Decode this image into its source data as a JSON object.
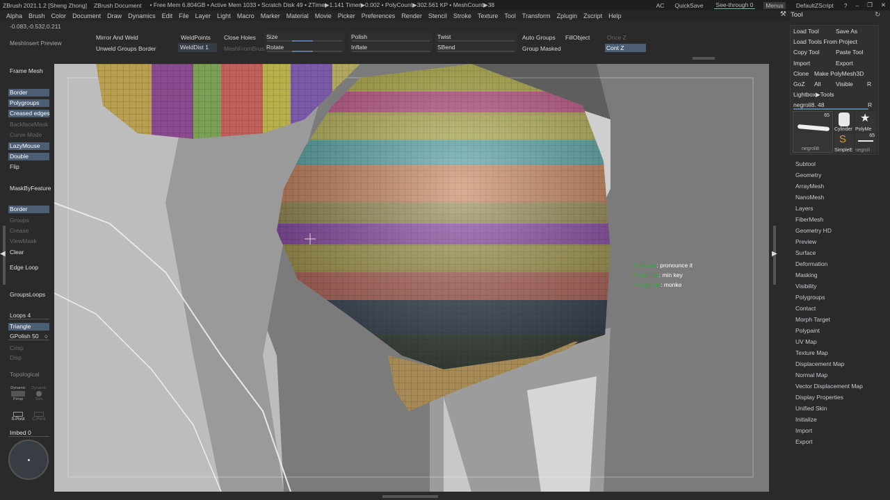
{
  "titlebar": {
    "app": "ZBrush 2021.1.2 [Sheng Zhong]",
    "document": "ZBrush Document",
    "stats": "• Free Mem 6.804GB • Active Mem 1033 • Scratch Disk 49 • ZTime▶1.141 Timer▶0.002 • PolyCount▶302.561 KP • MeshCount▶38",
    "ac": "AC",
    "quicksave": "QuickSave",
    "seethrough": "See-through  0",
    "menus": "Menus",
    "script": "DefaultZScript"
  },
  "menubar": [
    "Alpha",
    "Brush",
    "Color",
    "Document",
    "Draw",
    "Dynamics",
    "Edit",
    "File",
    "Layer",
    "Light",
    "Macro",
    "Marker",
    "Material",
    "Movie",
    "Picker",
    "Preferences",
    "Render",
    "Stencil",
    "Stroke",
    "Texture",
    "Tool",
    "Transform",
    "Zplugin",
    "Zscript",
    "Help"
  ],
  "coords": "-0.083,-0.532,0.211",
  "meshinsert": "MeshInsert Preview",
  "top": {
    "mirror_weld": "Mirror And Weld",
    "unweld_groups": "Unweld Groups Border",
    "weldpoints": "WeldPoints",
    "welddist": "WeldDist 1",
    "close_holes": "Close Holes",
    "meshfrombrush": "MeshFromBrus",
    "size": "Size",
    "rotate": "Rotate",
    "polish": "Polish",
    "inflate": "Inflate",
    "twist": "Twist",
    "sbend": "SBend",
    "auto_groups": "Auto Groups",
    "group_masked": "Group Masked",
    "fillobject": "FillObject",
    "once_z": "Once Z",
    "cont_z": "Cont Z"
  },
  "left": {
    "frame_mesh": "Frame Mesh",
    "border": "Border",
    "polygroups": "Polygroups",
    "creased_edges": "Creased edges",
    "backfacemask": "BackfaceMask",
    "curve_mode": "Curve Mode",
    "lazymouse": "LazyMouse",
    "double": "Double",
    "flip": "Flip",
    "maskbyfeature": "MaskByFeature",
    "border2": "Border",
    "groups": "Groups",
    "crease": "Crease",
    "viewmask": "ViewMask",
    "clear": "Clear",
    "edge_loop": "Edge Loop",
    "groupsloops": "GroupsLoops",
    "loops": "Loops 4",
    "triangle": "Triangle",
    "gpolish": "GPolish 50",
    "crisp": "Crisp",
    "disp": "Disp",
    "topological": "Topological",
    "dyn_persp": "Persp",
    "dyn_label": "Dynamic",
    "dyn_solo": "Solo",
    "spivot": "S.Pivot",
    "cpivot": "C.Pivot",
    "imbed": "Imbed 0"
  },
  "right": {
    "title": "Tool",
    "load_tool": "Load Tool",
    "save_as": "Save As",
    "load_from_project": "Load Tools From Project",
    "copy_tool": "Copy Tool",
    "paste_tool": "Paste Tool",
    "import": "Import",
    "export": "Export",
    "clone": "Clone",
    "make_polymesh": "Make PolyMesh3D",
    "goz": "GoZ",
    "all": "All",
    "visible": "Visible",
    "r": "R",
    "lightbox_tools": "Lightbox▶Tools",
    "current_tool": "negroli8. 48",
    "thumb_count1": "65",
    "thumb_count2": "65",
    "thumb_name1": "negroli8",
    "thumb_cylinder": "Cylinder",
    "thumb_polymesh": "PolyMe",
    "thumb_simple": "SimpleE",
    "thumb_negro": "negroli",
    "items": [
      "Subtool",
      "Geometry",
      "ArrayMesh",
      "NanoMesh",
      "Layers",
      "FiberMesh",
      "Geometry HD",
      "Preview",
      "Surface",
      "Deformation",
      "Masking",
      "Visibility",
      "Polygroups",
      "Contact",
      "Morph Target",
      "Polypaint",
      "UV Map",
      "Texture Map",
      "Displacement Map",
      "Normal Map",
      "Vector Displacement Map",
      "Display Properties",
      "Unified Skin",
      "Initialize",
      "Import",
      "Export"
    ]
  },
  "annotations": [
    {
      "key": "Prorouse",
      "val": ": pronounce it"
    },
    {
      "key": "PrmeHide",
      "val": ": min key"
    },
    {
      "key": "Frmdyhide",
      "val": ": monke"
    }
  ]
}
